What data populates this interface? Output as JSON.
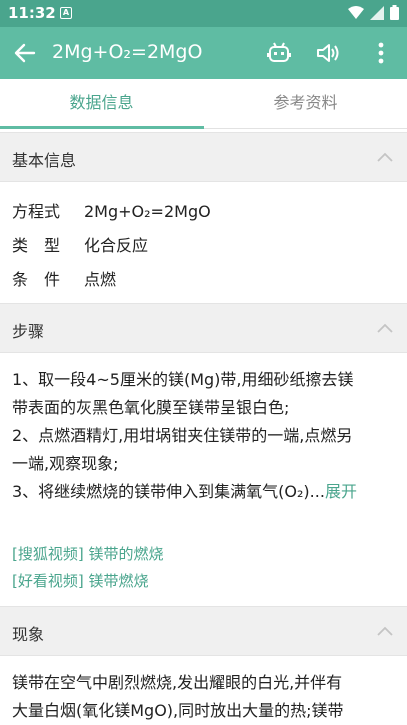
{
  "status_bar": {
    "time": "11:32",
    "notification_icon": "A"
  },
  "app_bar": {
    "title": "2Mg+O₂=2MgO"
  },
  "tabs": [
    {
      "label": "数据信息"
    },
    {
      "label": "参考资料"
    }
  ],
  "sections": {
    "basic": {
      "title": "基本信息",
      "rows": [
        {
          "key": "方程式",
          "value": "2Mg+O₂=2MgO"
        },
        {
          "key": "类　型",
          "value": "化合反应"
        },
        {
          "key": "条　件",
          "value": "点燃"
        }
      ]
    },
    "steps": {
      "title": "步骤",
      "lines": [
        "1、取一段4~5厘米的镁(Mg)带,用细砂纸擦去镁",
        "带表面的灰黑色氧化膜至镁带呈银白色;",
        "2、点燃酒精灯,用坩埚钳夹住镁带的一端,点燃另",
        "一端,观察现象;",
        "3、将继续燃烧的镁带伸入到集满氧气(O₂)..."
      ],
      "expand_label": "展开",
      "links": [
        "[搜狐视频] 镁带的燃烧",
        "[好看视频] 镁带燃烧"
      ]
    },
    "phenomenon": {
      "title": "现象",
      "lines": [
        "镁带在空气中剧烈燃烧,发出耀眼的白光,并伴有",
        "大量白烟(氧化镁MgO),同时放出大量的热;镁带"
      ]
    }
  },
  "colors": {
    "accent": "#5fbca3",
    "status": "#4aa58d",
    "link": "#4aa58d"
  }
}
